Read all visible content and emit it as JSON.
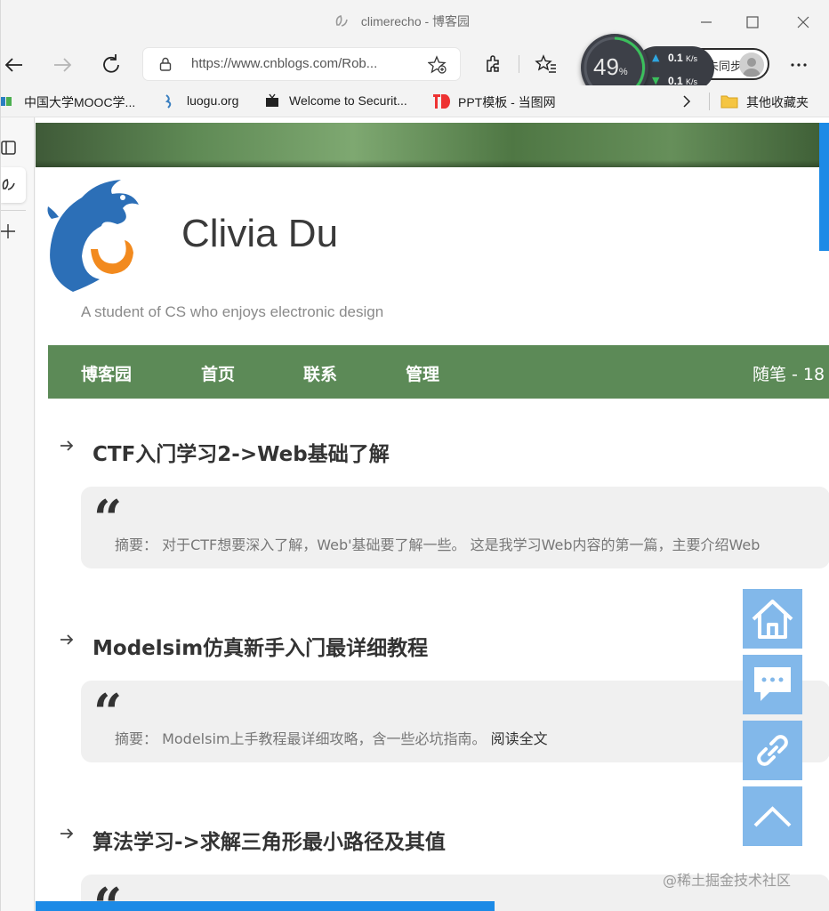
{
  "window": {
    "title": "climerecho - 博客园"
  },
  "nav": {
    "url": "https://www.cnblogs.com/Rob...",
    "sync_label": "未同步"
  },
  "speed_widget": {
    "percent": "49",
    "percent_unit": "%",
    "up_value": "0.1",
    "up_unit": "K/s",
    "down_value": "0.1",
    "down_unit": "K/s"
  },
  "bookmarks": [
    {
      "label": "中国大学MOOC学..."
    },
    {
      "label": "luogu.org"
    },
    {
      "label": "Welcome to Securit..."
    },
    {
      "label": "PPT模板 - 当图网"
    },
    {
      "label": "其他收藏夹"
    }
  ],
  "blog": {
    "title": "Clivia Du",
    "subtitle": "A student of CS who enjoys electronic design",
    "menu": [
      "博客园",
      "首页",
      "联系",
      "管理"
    ],
    "menu_right": "随笔 - 18"
  },
  "posts": [
    {
      "title": "CTF入门学习2->Web基础了解",
      "summary": "摘要：  对于CTF想要深入了解，Web'基础要了解一些。 这是我学习Web内容的第一篇，主要介绍Web",
      "read_more": ""
    },
    {
      "title": "Modelsim仿真新手入门最详细教程",
      "summary": "摘要：  Modelsim上手教程最详细攻略，含一些必坑指南。",
      "read_more": "阅读全文"
    },
    {
      "title": "算法学习->求解三角形最小路径及其值",
      "summary": "",
      "read_more": ""
    }
  ],
  "watermark": "@稀土掘金技术社区",
  "colors": {
    "menu_bg": "#5c8a57",
    "float_btn": "#82b8ea",
    "accent_blue": "#1c8ae6"
  },
  "icons": {
    "float_buttons": [
      "home-icon",
      "comment-icon",
      "link-icon",
      "back-to-top-icon"
    ]
  }
}
